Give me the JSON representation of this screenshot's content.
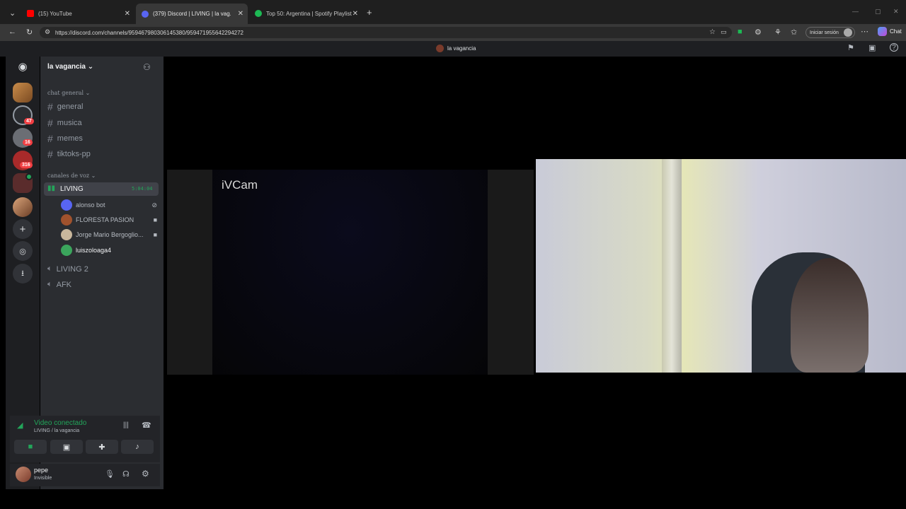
{
  "browser": {
    "tabs": [
      {
        "label": "(15) YouTube",
        "color": "#ff0000"
      },
      {
        "label": "(379) Discord | LIVING | la vag...",
        "color": "#5865f2"
      },
      {
        "label": "Top 50: Argentina | Spotify Playlist",
        "color": "#1db954"
      }
    ],
    "url": "https://discord.com/channels/959467980306145380/959471955642294272",
    "signin_label": "Iniciar sesión",
    "chat_label": "Chat"
  },
  "discord": {
    "top_title": "la vagancia",
    "server_name": "la vagancia",
    "guild_badges": [
      "47",
      "16",
      "316"
    ],
    "text_category": "chat general",
    "text_channels": [
      "general",
      "musica",
      "memes",
      "tiktoks-pp"
    ],
    "voice_category": "canales de voz",
    "active_voice": {
      "name": "LIVING",
      "timer": "5:04:04"
    },
    "voice_users": [
      {
        "name": "alonso bot",
        "icon": "camera-off-icon",
        "color": "#5865f2"
      },
      {
        "name": "FLORESTA PASION",
        "icon": "camera-icon",
        "color": "#a0522d"
      },
      {
        "name": "Jorge Mario Bergoglio...",
        "icon": "camera-icon",
        "color": "#c9b79c"
      },
      {
        "name": "luiszoloaga4",
        "icon": "",
        "color": "#3ba55c"
      }
    ],
    "voice_channels": [
      "LIVING 2",
      "AFK"
    ],
    "voice_status": "Video conectado",
    "voice_location": "LIVING / la vagancia",
    "user": {
      "name": "pepe",
      "status": "Invisible"
    },
    "stream_label": "iVCam"
  },
  "colors": {
    "accent": "#23a55a",
    "brand": "#5865f2"
  }
}
